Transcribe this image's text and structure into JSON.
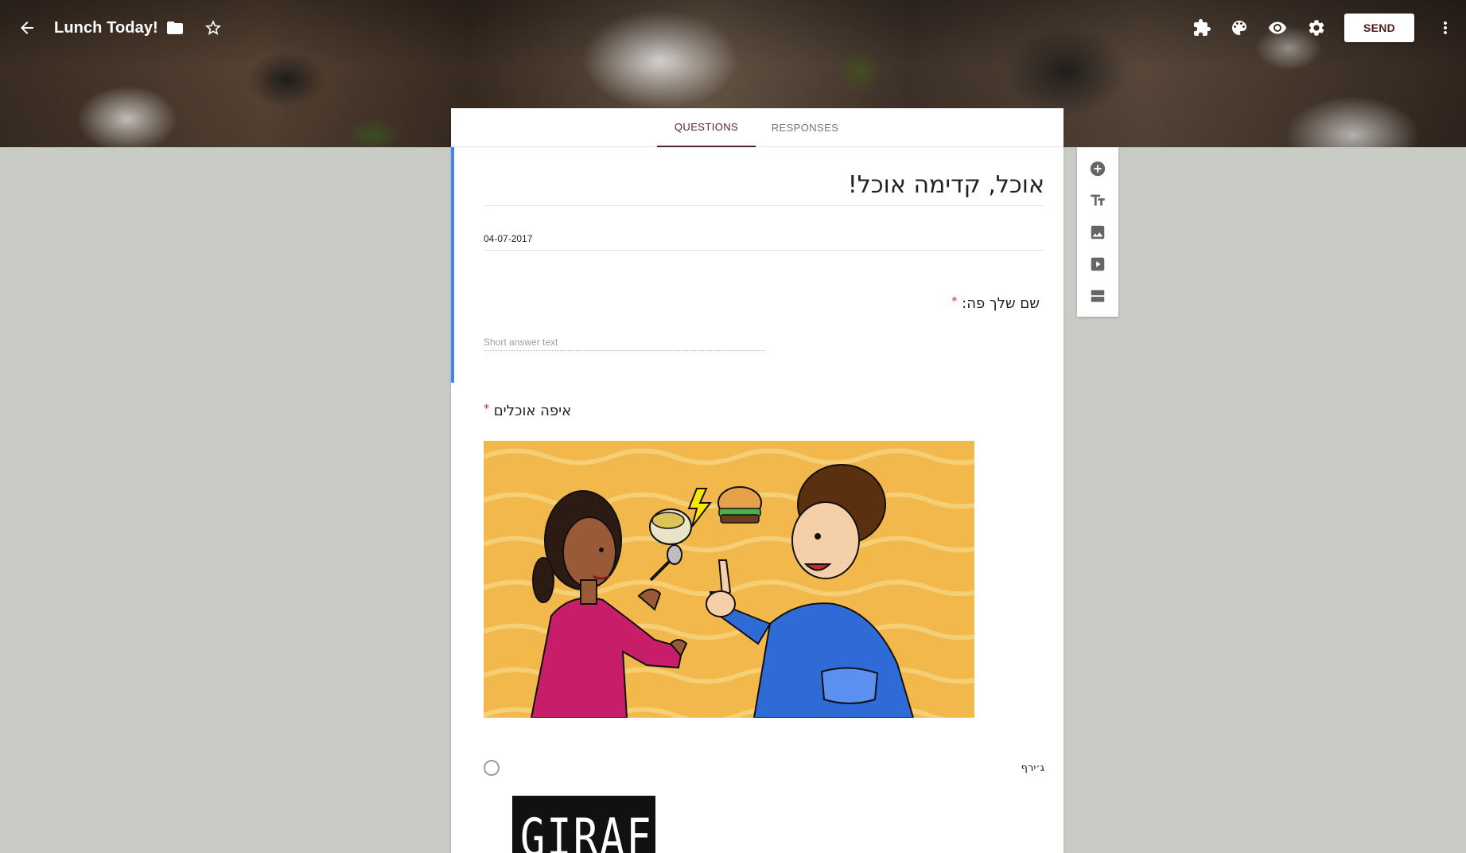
{
  "app": {
    "form_title": "Lunch Today!",
    "send_label": "SEND"
  },
  "tabs": [
    {
      "label": "QUESTIONS",
      "active": true
    },
    {
      "label": "RESPONSES",
      "active": false
    }
  ],
  "form": {
    "title": "אוכל, קדימה אוכל!",
    "description": "04-07-2017",
    "questions": [
      {
        "title": "שם שלך פה:",
        "required": true,
        "required_mark": "*",
        "answer_placeholder": "Short answer text"
      },
      {
        "title": "איפה אוכלים",
        "required": true,
        "required_mark": "*",
        "options": [
          {
            "label": "ג׳ירף",
            "logo_text": "GIRAFFE"
          }
        ]
      }
    ]
  },
  "icons": {
    "topbar": [
      "back-arrow-icon",
      "folder-icon",
      "star-icon",
      "addons-icon",
      "palette-icon",
      "preview-eye-icon",
      "settings-gear-icon",
      "more-vert-icon"
    ],
    "side_toolbar": [
      "add-question-icon",
      "add-title-icon",
      "add-image-icon",
      "add-video-icon",
      "add-section-icon"
    ]
  },
  "colors": {
    "accent": "#5c1f1f",
    "active_section": "#4285f4",
    "required": "#c62828",
    "background": "#c9ccc5"
  }
}
